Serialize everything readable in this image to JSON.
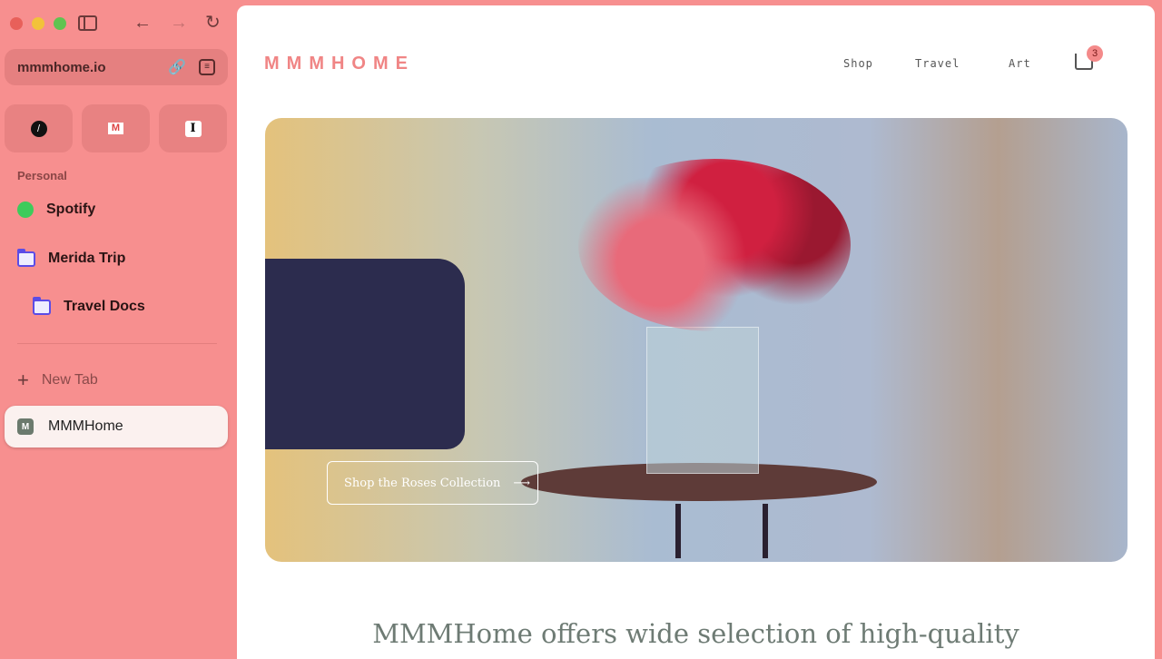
{
  "browser": {
    "url": "mmmhome.io",
    "pinned": [
      {
        "name": "Notion"
      },
      {
        "name": "Gmail"
      },
      {
        "name": "Instapaper"
      }
    ],
    "section": "Personal",
    "items": [
      {
        "label": "Spotify"
      },
      {
        "label": "Merida Trip"
      },
      {
        "label": "Travel Docs"
      }
    ],
    "new_tab": "New Tab",
    "active_tab": {
      "label": "MMMHome",
      "favicon": "M"
    }
  },
  "site": {
    "logo": "MMMHOME",
    "nav": [
      "Shop",
      "Travel",
      "Art"
    ],
    "cart_count": "3",
    "hero": {
      "cta": "Shop the Roses Collection"
    },
    "tagline": "MMMHome offers wide selection of high-quality"
  },
  "colors": {
    "sidebar": "#f78f8f",
    "accent": "#f08585"
  }
}
